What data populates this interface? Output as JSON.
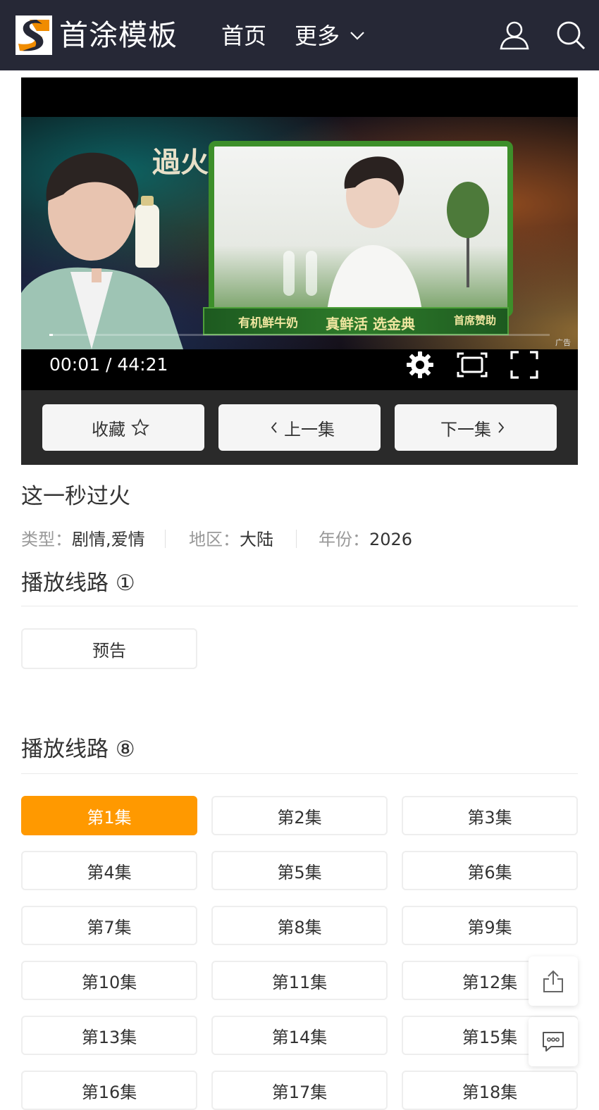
{
  "header": {
    "site_name": "首涂模板",
    "nav": [
      {
        "label": "首页"
      },
      {
        "label": "更多"
      }
    ],
    "icons": [
      "user-icon",
      "search-icon"
    ]
  },
  "player": {
    "time_display": "00:01 / 44:21",
    "ad_label": "广告",
    "progress_percent": 0.04,
    "ad_creative": {
      "title_art": "過火",
      "sponsor_items": [
        "有机鲜牛奶",
        "真鲜活 选金典",
        "首席赞助"
      ]
    },
    "control_icons": [
      "settings-icon",
      "picture-in-picture-icon",
      "fullscreen-icon"
    ]
  },
  "actions": {
    "favorite": "收藏",
    "prev": "上一集",
    "next": "下一集"
  },
  "video": {
    "title": "这一秒过火",
    "meta": [
      {
        "key": "类型：",
        "value": "剧情,爱情"
      },
      {
        "key": "地区：",
        "value": "大陆"
      },
      {
        "key": "年份：",
        "value": "2026"
      }
    ]
  },
  "sources": [
    {
      "title": "播放线路 ①",
      "episodes": [
        "预告"
      ]
    },
    {
      "title": "播放线路 ⑧",
      "active_index": 0,
      "episodes": [
        "第1集",
        "第2集",
        "第3集",
        "第4集",
        "第5集",
        "第6集",
        "第7集",
        "第8集",
        "第9集",
        "第10集",
        "第11集",
        "第12集",
        "第13集",
        "第14集",
        "第15集",
        "第16集",
        "第17集",
        "第18集"
      ]
    }
  ],
  "floating": [
    "share-icon",
    "comment-icon"
  ],
  "colors": {
    "header_bg": "#262836",
    "accent": "#ff9900",
    "action_bar_bg": "#2a2a2a"
  }
}
